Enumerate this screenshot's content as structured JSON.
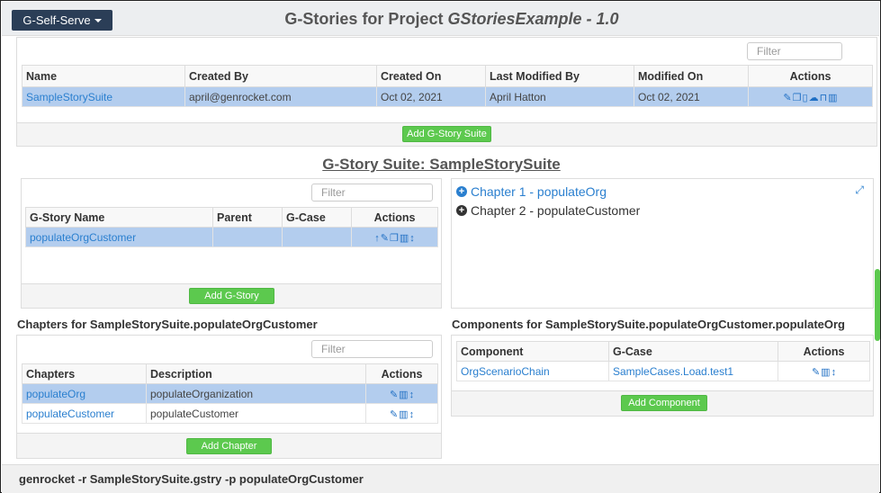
{
  "header": {
    "self_serve_label": "G-Self-Serve",
    "title_prefix": "G-Stories for Project ",
    "title_project": "GStoriesExample - 1.0"
  },
  "suites": {
    "filter_placeholder": "Filter",
    "columns": [
      "Name",
      "Created By",
      "Created On",
      "Last Modified By",
      "Modified On",
      "Actions"
    ],
    "rows": [
      {
        "name": "SampleStorySuite",
        "created_by": "april@genrocket.com",
        "created_on": "Oct 02, 2021",
        "last_modified_by": "April Hatton",
        "modified_on": "Oct 02, 2021"
      }
    ],
    "add_button": "Add G-Story Suite"
  },
  "suite_title": "G-Story Suite: SampleStorySuite",
  "stories": {
    "filter_placeholder": "Filter",
    "columns": [
      "G-Story Name",
      "Parent",
      "G-Case",
      "Actions"
    ],
    "rows": [
      {
        "name": "populateOrgCustomer",
        "parent": "",
        "gcase": ""
      }
    ],
    "add_button": "Add G-Story"
  },
  "chapter_tree": {
    "items": [
      {
        "label": "Chapter 1 - populateOrg",
        "icon": "plus-circle-icon",
        "color": "#2a7fcf"
      },
      {
        "label": "Chapter 2 - populateCustomer",
        "icon": "plus-circle-icon",
        "color": "#333333"
      }
    ]
  },
  "chapters": {
    "heading": "Chapters for SampleStorySuite.populateOrgCustomer",
    "filter_placeholder": "Filter",
    "columns": [
      "Chapters",
      "Description",
      "Actions"
    ],
    "rows": [
      {
        "name": "populateOrg",
        "description": "populateOrganization"
      },
      {
        "name": "populateCustomer",
        "description": "populateCustomer"
      }
    ],
    "add_button": "Add Chapter"
  },
  "components": {
    "heading": "Components for SampleStorySuite.populateOrgCustomer.populateOrg",
    "columns": [
      "Component",
      "G-Case",
      "Actions"
    ],
    "rows": [
      {
        "component": "OrgScenarioChain",
        "gcase": "SampleCases.Load.test1"
      }
    ],
    "add_button": "Add Component"
  },
  "command": "genrocket -r SampleStorySuite.gstry -p populateOrgCustomer",
  "colors": {
    "accent": "#2a7fcf",
    "selected_row": "#b3cdee",
    "button_green": "#5cc94e",
    "navbar": "#2b3e57"
  }
}
